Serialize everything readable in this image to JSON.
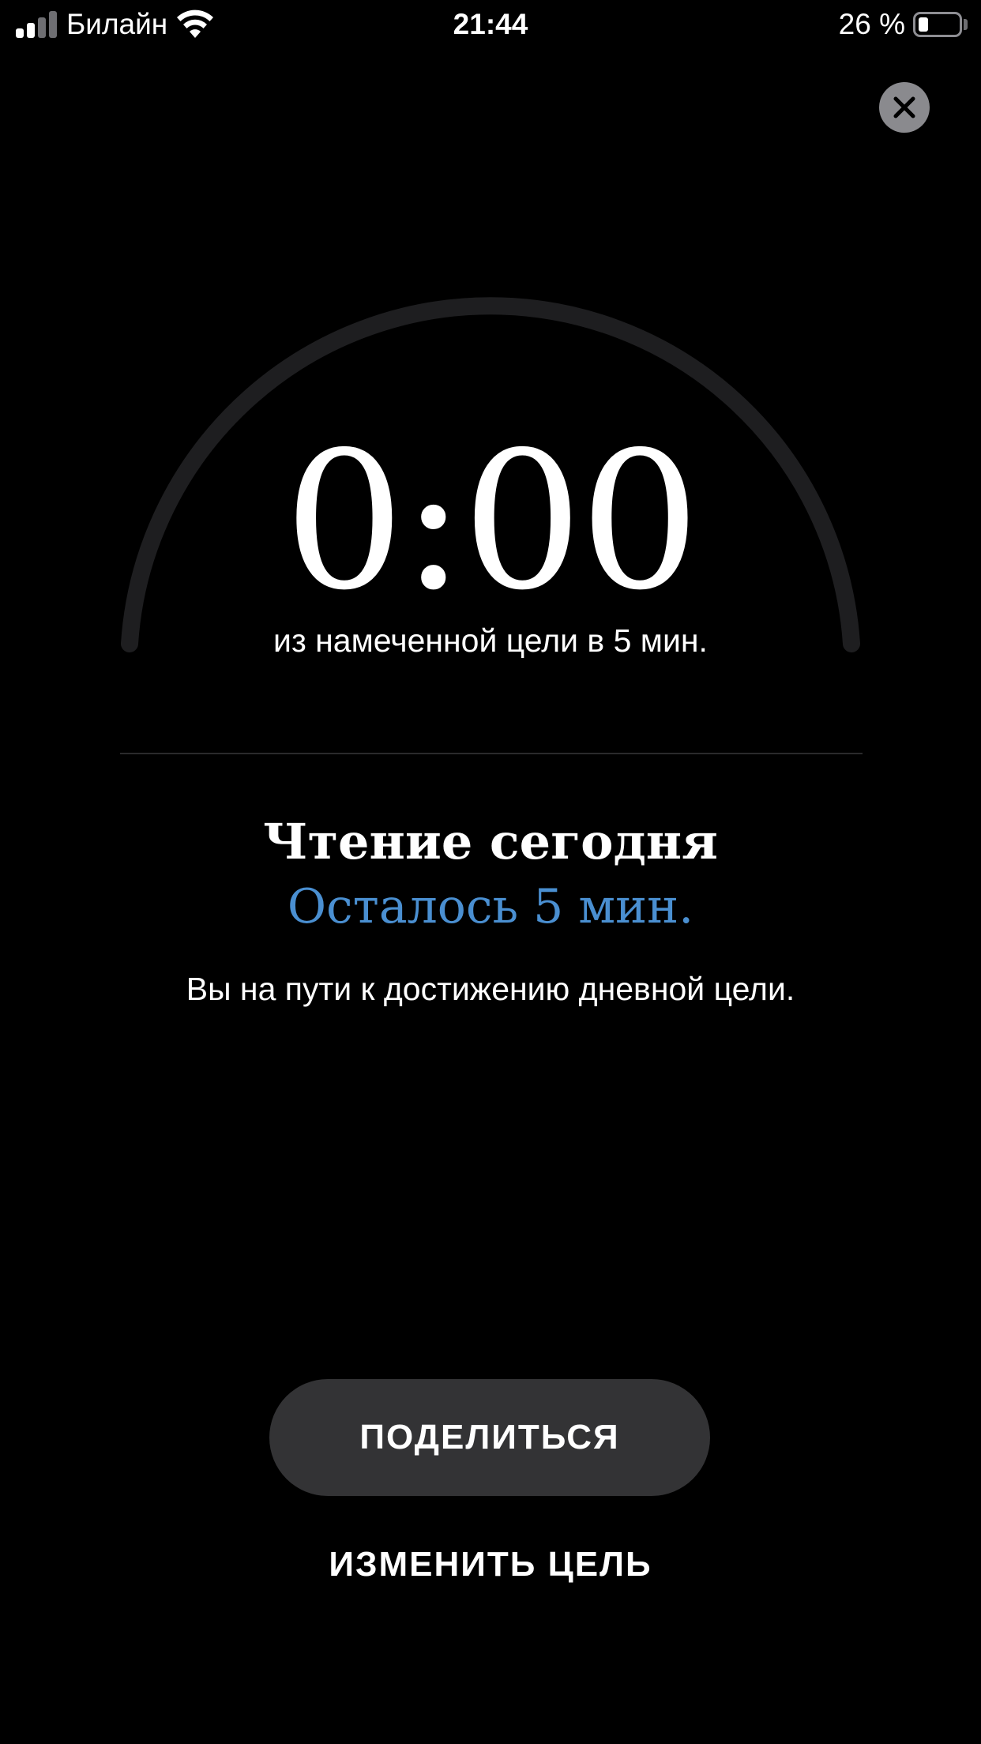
{
  "status_bar": {
    "carrier": "Билайн",
    "time": "21:44",
    "battery_percent": "26 %",
    "battery_level": 0.26,
    "signal_bars_active": 2,
    "signal_bars_total": 4,
    "signal_icon": "cellular-signal-icon",
    "wifi_icon": "wifi-icon",
    "battery_icon": "battery-icon"
  },
  "close": {
    "icon": "close-icon"
  },
  "reading_goal": {
    "time_read": "0:00",
    "progress": 0,
    "caption": "из намеченной цели в 5 мин.",
    "title": "Чтение сегодня",
    "remaining": "Осталось 5 мин.",
    "message": "Вы на пути к достижению дневной цели."
  },
  "actions": {
    "share_label": "ПОДЕЛИТЬСЯ",
    "change_goal_label": "ИЗМЕНИТЬ ЦЕЛЬ"
  },
  "colors": {
    "background": "#000000",
    "text": "#ffffff",
    "accent_blue": "#4a8fd1",
    "gauge_track": "#1e1e20",
    "gauge_progress": "#4a8fd1",
    "button_fill": "#333335",
    "status_inactive": "#6e6e72",
    "battery_fill": "#ffffff"
  }
}
